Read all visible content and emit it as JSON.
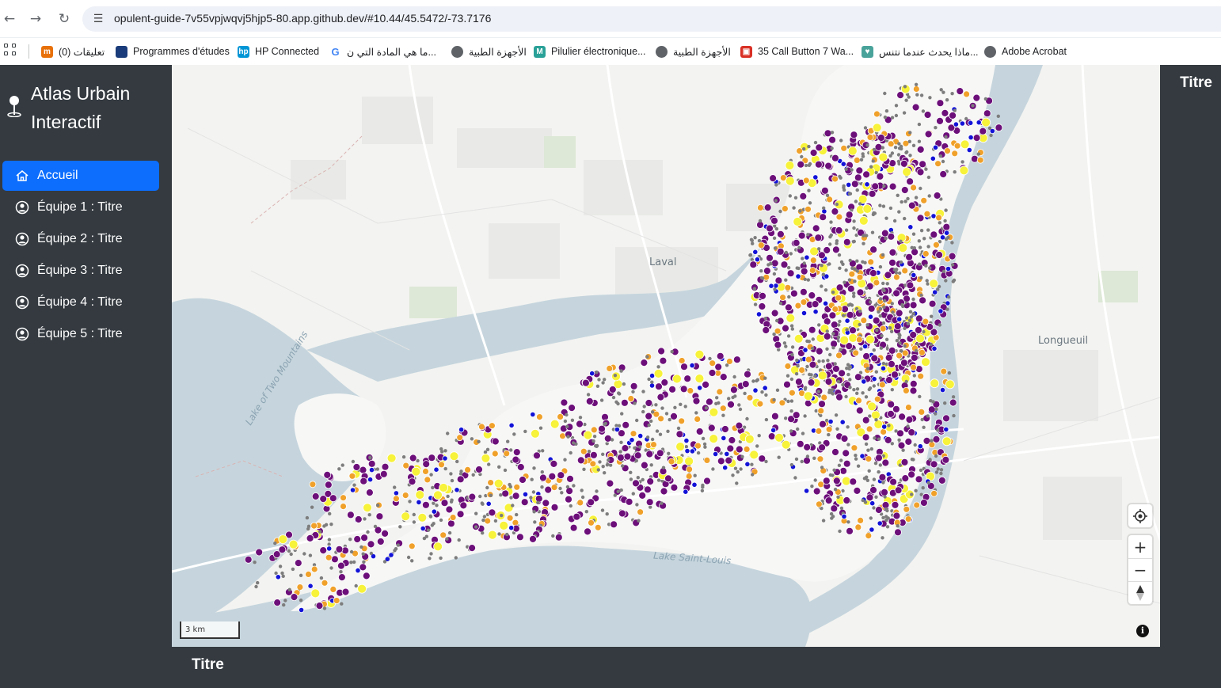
{
  "browser": {
    "url": "opulent-guide-7v55vpjwqvj5hjp5-80.app.github.dev/#10.44/45.5472/-73.7176",
    "bookmarks": [
      {
        "label": "تعليقات (0)",
        "icon": "mustache-favicon",
        "color": "#e8710a"
      },
      {
        "label": "Programmes d'études",
        "icon": "flag-favicon",
        "color": "#1a3c7a"
      },
      {
        "label": "HP Connected",
        "icon": "hp-favicon",
        "color": "#0096d6"
      },
      {
        "label": "ما هي المادة التي ن...",
        "icon": "google-favicon",
        "color": "#4285f4"
      },
      {
        "label": "الأجهزة الطبية",
        "icon": "globe-favicon",
        "color": "#5f6368"
      },
      {
        "label": "Pilulier électronique...",
        "icon": "m-favicon",
        "color": "#2aa198"
      },
      {
        "label": "الأجهزة الطبية",
        "icon": "globe-favicon",
        "color": "#5f6368"
      },
      {
        "label": "35 Call Button 7 Wa...",
        "icon": "store-favicon",
        "color": "#d93025"
      },
      {
        "label": "ماذا يحدث عندما نتنس...",
        "icon": "heart-favicon",
        "color": "#4aa39b"
      },
      {
        "label": "Adobe Acrobat",
        "icon": "globe-favicon",
        "color": "#5f6368"
      }
    ]
  },
  "sidebar": {
    "brand": "Atlas Urbain Interactif",
    "items": [
      {
        "label": "Accueil",
        "icon": "home-icon",
        "active": true
      },
      {
        "label": "Équipe 1 : Titre",
        "icon": "user-circle-icon"
      },
      {
        "label": "Équipe 2 : Titre",
        "icon": "user-circle-icon"
      },
      {
        "label": "Équipe 3 : Titre",
        "icon": "user-circle-icon"
      },
      {
        "label": "Équipe 4 : Titre",
        "icon": "user-circle-icon"
      },
      {
        "label": "Équipe 5 : Titre",
        "icon": "user-circle-icon"
      }
    ]
  },
  "map": {
    "labels": {
      "laval": "Laval",
      "longueuil": "Longueuil",
      "lake_two_mountains": "Lake of Two Mountains",
      "lake_saint_louis": "Lake Saint-Louis"
    },
    "scale": "3 km",
    "point_colors": {
      "purple": "#6d0f7a",
      "orange": "#f0a12a",
      "yellow": "#f7f23a",
      "blue": "#1212d8",
      "gray": "#7d7d7d"
    }
  },
  "panels": {
    "right_title": "Titre",
    "footer_title": "Titre"
  }
}
